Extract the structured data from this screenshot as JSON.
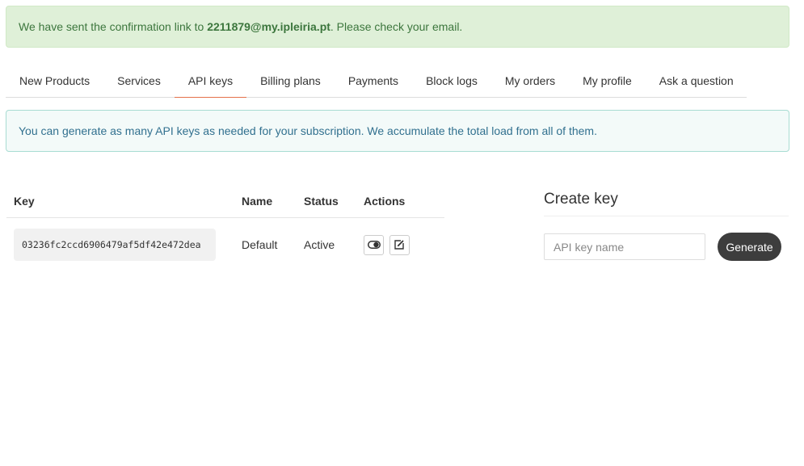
{
  "notice": {
    "prefix": "We have sent the confirmation link to ",
    "email": "2211879@my.ipleiria.pt",
    "suffix": ". Please check your email."
  },
  "tabs": [
    {
      "label": "New Products"
    },
    {
      "label": "Services"
    },
    {
      "label": "API keys",
      "active": true
    },
    {
      "label": "Billing plans"
    },
    {
      "label": "Payments"
    },
    {
      "label": "Block logs"
    },
    {
      "label": "My orders"
    },
    {
      "label": "My profile"
    },
    {
      "label": "Ask a question"
    }
  ],
  "info": "You can generate as many API keys as needed for your subscription. We accumulate the total load from all of them.",
  "table": {
    "headers": {
      "key": "Key",
      "name": "Name",
      "status": "Status",
      "actions": "Actions"
    },
    "rows": [
      {
        "key": "03236fc2ccd6906479af5df42e472dea",
        "name": "Default",
        "status": "Active"
      }
    ]
  },
  "create": {
    "title": "Create key",
    "placeholder": "API key name",
    "button": "Generate"
  },
  "icons": {
    "toggle": "toggle-icon",
    "edit": "edit-icon"
  },
  "colors": {
    "success_bg": "#dff0d8",
    "success_text": "#3c763d",
    "info_bg": "#f3faf9",
    "info_text": "#31708f",
    "active_tab": "#e4704a",
    "button_bg": "#3d3d3d"
  }
}
